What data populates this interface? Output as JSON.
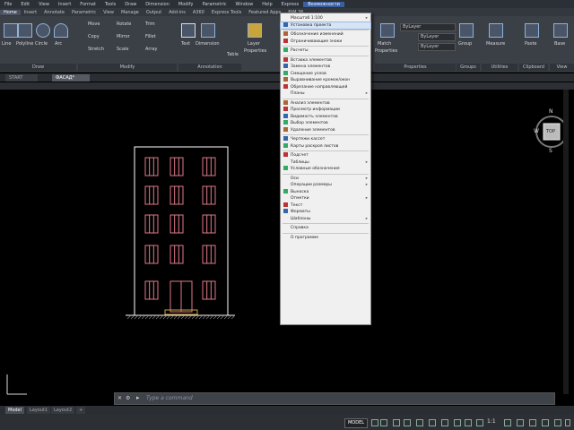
{
  "menubar": {
    "items": [
      "File",
      "Edit",
      "View",
      "Insert",
      "Format",
      "Tools",
      "Draw",
      "Dimension",
      "Modify",
      "Parametric",
      "Window",
      "Help",
      "Express",
      "Возможности"
    ],
    "active_index": 13
  },
  "ribbon_tabs": {
    "items": [
      "Home",
      "Insert",
      "Annotate",
      "Parametric",
      "View",
      "Manage",
      "Output",
      "Add-ins",
      "A360",
      "Express Tools",
      "Featured Apps",
      "BIM 36"
    ],
    "active_index": 0
  },
  "ribbon": {
    "draw_tools": [
      "Line",
      "Polyline",
      "Circle",
      "Arc"
    ],
    "modify_tools": [
      "Move",
      "Rotate",
      "Trim",
      "Copy",
      "Mirror",
      "Fillet",
      "Stretch",
      "Scale",
      "Array"
    ],
    "annotation_tools": [
      "Text",
      "Dimension",
      "Table"
    ],
    "layer_tools": [
      "Layer",
      "Properties"
    ],
    "block_tools": [
      "Match",
      "Properties"
    ],
    "group_tool": "Group",
    "utilities_tool": "Measure",
    "clipboard_tool": "Paste",
    "base_tool": "Base",
    "layer_dropdown": "ByLayer",
    "panel_titles": {
      "draw": "Draw",
      "modify": "Modify",
      "annotation": "Annotation",
      "properties": "Properties",
      "groups": "Groups",
      "utilities": "Utilities",
      "clipboard": "Clipboard",
      "view": "View"
    }
  },
  "doc_tabs": [
    "START",
    "ФАСАД*"
  ],
  "dropdown": {
    "items": [
      {
        "label": "Масштаб 1:100",
        "icon": "none",
        "arrow": true
      },
      {
        "label": "Установка проекта",
        "icon": "pen-icon",
        "arrow": false,
        "highlight": true
      },
      {
        "sep": true
      },
      {
        "label": "Обозначение изменений",
        "icon": "doc-icon",
        "arrow": false
      },
      {
        "label": "Ограничивающие знаки",
        "icon": "pin-icon",
        "arrow": false
      },
      {
        "sep": true
      },
      {
        "label": "Расчеты",
        "icon": "calc-icon",
        "arrow": false
      },
      {
        "sep": true
      },
      {
        "label": "Вставка элементов",
        "icon": "insert-icon",
        "arrow": false
      },
      {
        "label": "Замена элементов",
        "icon": "replace-icon",
        "arrow": false
      },
      {
        "label": "Смещение узлов",
        "icon": "offset-icon",
        "arrow": false
      },
      {
        "label": "Выравнивание кромок/окон",
        "icon": "align-icon",
        "arrow": false
      },
      {
        "label": "Обрезание направляющей",
        "icon": "cut-icon",
        "arrow": false
      },
      {
        "label": "Планы",
        "icon": "none",
        "arrow": true
      },
      {
        "sep": true
      },
      {
        "label": "Анализ элементов",
        "icon": "analyze-icon",
        "arrow": false
      },
      {
        "label": "Просмотр информации",
        "icon": "info-icon",
        "arrow": false
      },
      {
        "label": "Видимость элементов",
        "icon": "eye-icon",
        "arrow": false
      },
      {
        "label": "Выбор элементов",
        "icon": "select-icon",
        "arrow": false
      },
      {
        "label": "Удаление элементов",
        "icon": "delete-icon",
        "arrow": false
      },
      {
        "sep": true
      },
      {
        "label": "Чертежи кассет",
        "icon": "drawing-icon",
        "arrow": false
      },
      {
        "label": "Карты раскроя листов",
        "icon": "sheet-icon",
        "arrow": false
      },
      {
        "sep": true
      },
      {
        "label": "Подсчет",
        "icon": "count-icon",
        "arrow": false
      },
      {
        "label": "Таблицы",
        "icon": "none",
        "arrow": true
      },
      {
        "label": "Условные обозначения",
        "icon": "legend-icon",
        "arrow": false
      },
      {
        "sep": true
      },
      {
        "label": "Оси",
        "icon": "none",
        "arrow": true
      },
      {
        "label": "Операции размеры",
        "icon": "none",
        "arrow": true
      },
      {
        "label": "Выноска",
        "icon": "leader-icon",
        "arrow": false
      },
      {
        "label": "Отметки",
        "icon": "none",
        "arrow": true
      },
      {
        "label": "Текст",
        "icon": "text-icon",
        "arrow": false
      },
      {
        "label": "Форматы",
        "icon": "format-icon",
        "arrow": false
      },
      {
        "label": "Шаблоны",
        "icon": "none",
        "arrow": true
      },
      {
        "sep": true
      },
      {
        "label": "Справка",
        "icon": "none",
        "arrow": false
      },
      {
        "sep": true
      },
      {
        "label": "О программе",
        "icon": "none",
        "arrow": false
      }
    ]
  },
  "viewcube": {
    "north": "N",
    "south": "S",
    "west": "W",
    "top": "TOP"
  },
  "command_line": {
    "placeholder": "Type a command"
  },
  "layout_tabs": [
    "Model",
    "Layout1",
    "Layout2"
  ],
  "statusbar": {
    "model": "MODEL",
    "scale": "1:1"
  },
  "colors": {
    "facade_line": "#ffffff",
    "window": "#e07a8a",
    "accent": "#3a5fa0"
  }
}
